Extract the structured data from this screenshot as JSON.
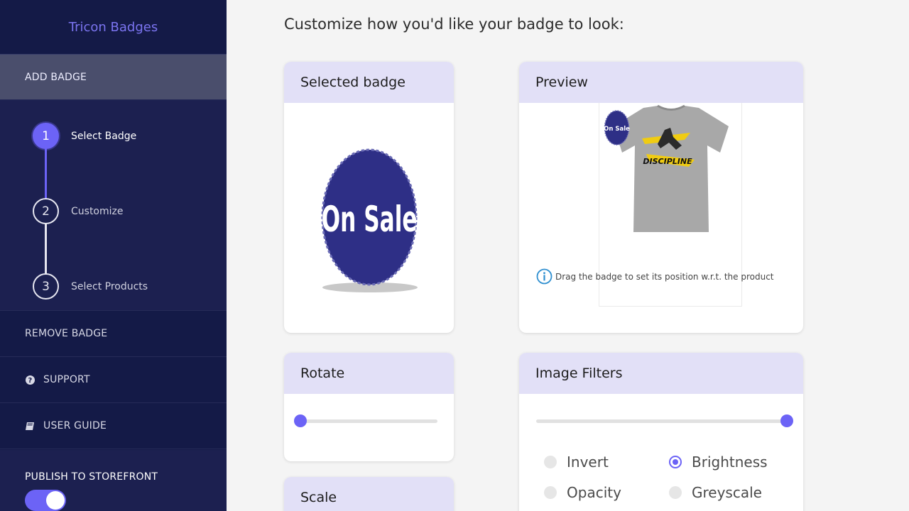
{
  "sidebar": {
    "brand": "Tricon Badges",
    "add_badge": "ADD BADGE",
    "steps": [
      {
        "number": "1",
        "label": "Select Badge",
        "state": "current"
      },
      {
        "number": "2",
        "label": "Customize",
        "state": "pending"
      },
      {
        "number": "3",
        "label": "Select Products",
        "state": "pending"
      }
    ],
    "remove_badge": "REMOVE BADGE",
    "support": "SUPPORT",
    "user_guide": "USER GUIDE",
    "publish_label": "PUBLISH TO STOREFRONT",
    "publish_enabled": true
  },
  "main": {
    "heading": "Customize how you'd like your badge to look:",
    "selected_badge": {
      "title": "Selected badge",
      "badge_text": "On Sale"
    },
    "preview": {
      "title": "Preview",
      "badge_text": "On Sale",
      "shirt_text": "DISCIPLINE",
      "hint": "Drag the badge to set its position w.r.t. the product"
    },
    "rotate": {
      "title": "Rotate",
      "value_fraction": 0.0
    },
    "image_filters": {
      "title": "Image Filters",
      "value_fraction": 1.0,
      "options": [
        {
          "label": "Invert",
          "checked": false
        },
        {
          "label": "Brightness",
          "checked": true
        },
        {
          "label": "Opacity",
          "checked": false
        },
        {
          "label": "Greyscale",
          "checked": false
        }
      ]
    },
    "scale": {
      "title": "Scale"
    }
  },
  "colors": {
    "sidebar_bg": "#141a47",
    "accent": "#6c63f6",
    "card_header_bg": "#e2e0f7",
    "badge_blue": "#2e2f86"
  }
}
